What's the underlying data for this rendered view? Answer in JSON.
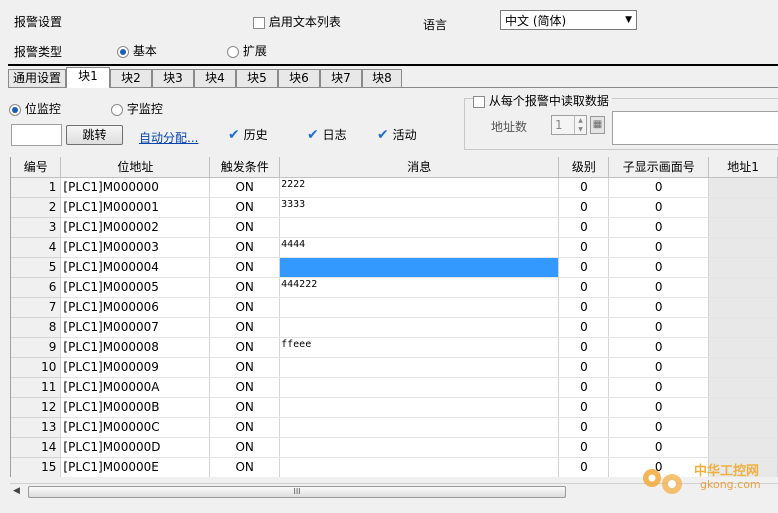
{
  "alarm_settings": {
    "label": "报警设置"
  },
  "enable_text_list": {
    "label": "启用文本列表",
    "checked": false
  },
  "language": {
    "label": "语言",
    "selected": "中文 (简体)"
  },
  "alarm_type": {
    "label": "报警类型",
    "options": [
      "基本",
      "扩展"
    ],
    "selected": "基本"
  },
  "tabs": [
    "通用设置",
    "块1",
    "块2",
    "块3",
    "块4",
    "块5",
    "块6",
    "块7",
    "块8"
  ],
  "active_tab": "块1",
  "monitor": {
    "bit_label": "位监控",
    "word_label": "字监控",
    "selected": "位监控"
  },
  "jump_button": "跳转",
  "auto_assign_link": "自动分配...",
  "checks": {
    "history": "历史",
    "log": "日志",
    "activity": "活动"
  },
  "read_data": {
    "label": "从每个报警中读取数据",
    "checked": false,
    "addr_count_label": "地址数",
    "addr_count_value": "1"
  },
  "table": {
    "columns": [
      "编号",
      "位地址",
      "触发条件",
      "消息",
      "级别",
      "子显示画面号",
      "地址1"
    ],
    "rows": [
      [
        "1",
        "[PLC1]M000000",
        "ON",
        "2222",
        "0",
        "0"
      ],
      [
        "2",
        "[PLC1]M000001",
        "ON",
        "3333",
        "0",
        "0"
      ],
      [
        "3",
        "[PLC1]M000002",
        "ON",
        "",
        "0",
        "0"
      ],
      [
        "4",
        "[PLC1]M000003",
        "ON",
        "4444",
        "0",
        "0"
      ],
      [
        "5",
        "[PLC1]M000004",
        "ON",
        "",
        "0",
        "0"
      ],
      [
        "6",
        "[PLC1]M000005",
        "ON",
        "444222",
        "0",
        "0"
      ],
      [
        "7",
        "[PLC1]M000006",
        "ON",
        "",
        "0",
        "0"
      ],
      [
        "8",
        "[PLC1]M000007",
        "ON",
        "",
        "0",
        "0"
      ],
      [
        "9",
        "[PLC1]M000008",
        "ON",
        "ffeee",
        "0",
        "0"
      ],
      [
        "10",
        "[PLC1]M000009",
        "ON",
        "",
        "0",
        "0"
      ],
      [
        "11",
        "[PLC1]M00000A",
        "ON",
        "",
        "0",
        "0"
      ],
      [
        "12",
        "[PLC1]M00000B",
        "ON",
        "",
        "0",
        "0"
      ],
      [
        "13",
        "[PLC1]M00000C",
        "ON",
        "",
        "0",
        "0"
      ],
      [
        "14",
        "[PLC1]M00000D",
        "ON",
        "",
        "0",
        "0"
      ],
      [
        "15",
        "[PLC1]M00000E",
        "ON",
        "",
        "0",
        "0"
      ]
    ],
    "selected_row": 5
  },
  "scrollbar": {
    "thumb_glyph": "III"
  },
  "watermark": {
    "title": "中华工控网",
    "url": "gkong.com"
  }
}
